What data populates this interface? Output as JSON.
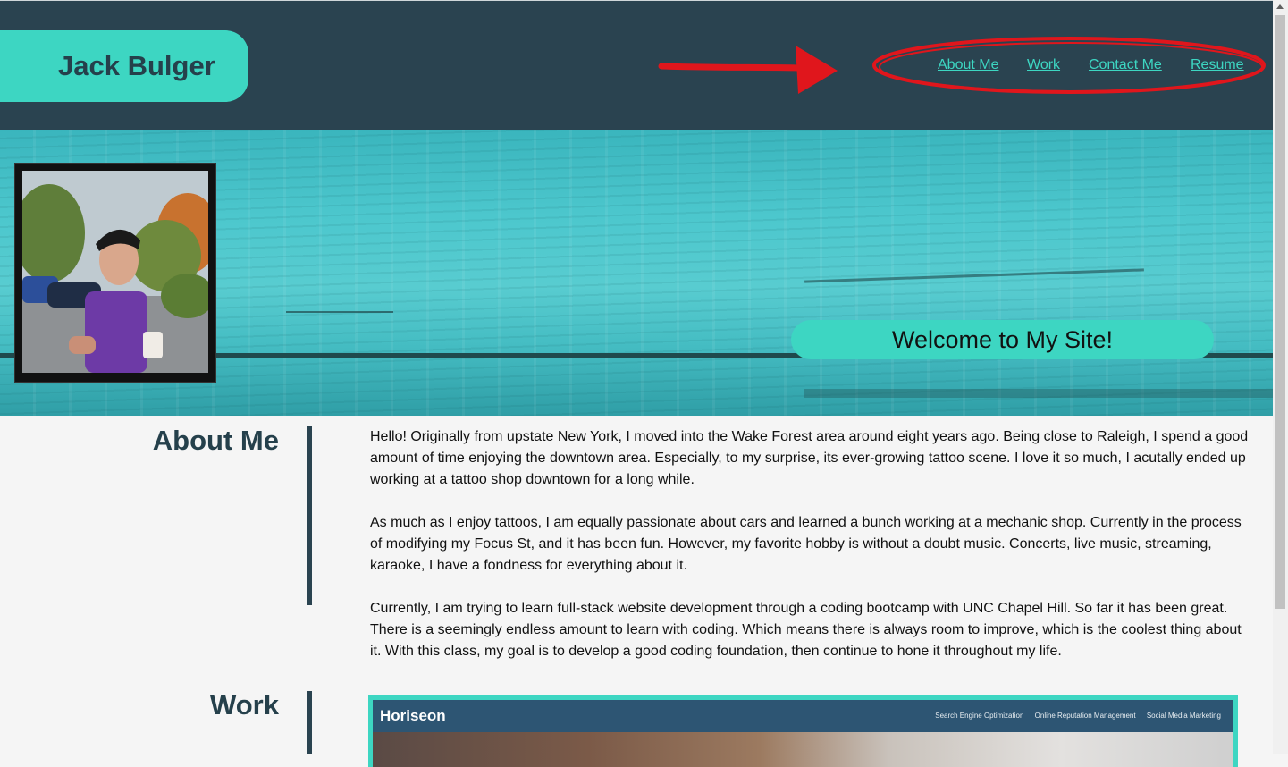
{
  "header": {
    "name": "Jack Bulger",
    "nav": [
      "About Me",
      "Work",
      "Contact Me",
      "Resume"
    ]
  },
  "hero": {
    "welcome": "Welcome to My Site!"
  },
  "about": {
    "title": "About Me",
    "paragraphs": [
      "Hello! Originally from upstate New York, I moved into the Wake Forest area around eight years ago. Being close to Raleigh, I spend a good amount of time enjoying the downtown area. Especially, to my surprise, its ever-growing tattoo scene. I love it so much, I acutally ended up working at a tattoo shop downtown for a long while.",
      "As much as I enjoy tattoos, I am equally passionate about cars and learned a bunch working at a mechanic shop. Currently in the process of modifying my Focus St, and it has been fun. However, my favorite hobby is without a doubt music. Concerts, live music, streaming, karaoke, I have a fondness for everything about it.",
      "Currently, I am trying to learn full-stack website development through a coding bootcamp with UNC Chapel Hill. So far it has been great. There is a seemingly endless amount to learn with coding. Which means there is always room to improve, which is the coolest thing about it. With this class, my goal is to develop a good coding foundation, then continue to hone it throughout my life."
    ]
  },
  "work": {
    "title": "Work",
    "preview": {
      "brand": "Horiseon",
      "links": [
        "Search Engine Optimization",
        "Online Reputation Management",
        "Social Media Marketing"
      ]
    }
  },
  "colors": {
    "header_bg": "#2a4350",
    "accent": "#3dd6c2",
    "annotation": "#e0161c"
  }
}
